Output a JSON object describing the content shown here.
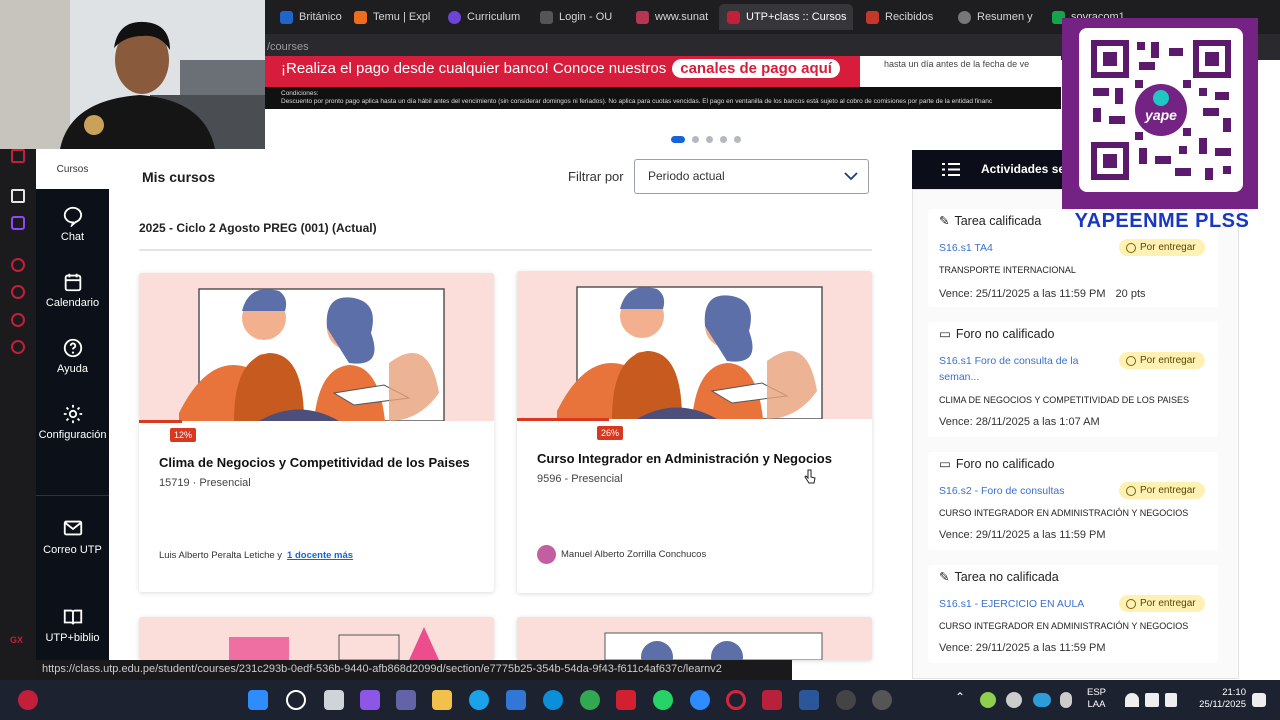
{
  "browser": {
    "tabs": [
      {
        "label": "Británico | A",
        "color": "#1f66c8"
      },
      {
        "label": "Temu | Expl",
        "color": "#ef6c1a"
      },
      {
        "label": "Curriculum",
        "color": "#6d44d8"
      },
      {
        "label": "Login - OU",
        "color": "#444"
      },
      {
        "label": "www.sunat",
        "color": "#b63552"
      },
      {
        "label": "UTP+class :: Cursos",
        "color": "#c21f3a"
      },
      {
        "label": "Recibidos",
        "color": "#c4382a"
      },
      {
        "label": "Resumen y",
        "color": "#777"
      },
      {
        "label": "sovracom1",
        "color": "#14a44a"
      }
    ],
    "address_fragment": "/courses"
  },
  "banner": {
    "main_text": "¡Realiza el pago desde cualquier banco! Conoce nuestros",
    "pill_text": "canales de pago aquí",
    "right_text": "hasta un día antes de la fecha de ve",
    "conditions_label": "Condiciones:",
    "conditions_text": "Descuento por pronto pago aplica hasta un día hábil antes del vencimiento (sin considerar domingos ni feriados). No aplica para cuotas vencidas. El pago en ventanilla de los bancos está sujeto al cobro de comisiones por parte de la entidad financ"
  },
  "sidebar": {
    "items": [
      {
        "label": "Cursos"
      },
      {
        "label": "Chat"
      },
      {
        "label": "Calendario"
      },
      {
        "label": "Ayuda"
      },
      {
        "label": "Configuración"
      },
      {
        "label": "Correo UTP"
      },
      {
        "label": "UTP+biblio"
      }
    ]
  },
  "main": {
    "heading": "Mis cursos",
    "filter_label": "Filtrar por",
    "filter_value": "Periodo actual",
    "period": "2025 - Ciclo 2 Agosto PREG (001) (Actual)",
    "carousel_dots": 5,
    "courses": [
      {
        "progress_label": "12%",
        "progress": 0.12,
        "title": "Clima de Negocios y Competitividad de los Paises",
        "subtitle": "15719 · Presencial",
        "teacher": "Luis Alberto Peralta Letiche y",
        "more_teachers": "1 docente más"
      },
      {
        "progress_label": "26%",
        "progress": 0.26,
        "title": "Curso Integrador en Administración y Negocios",
        "subtitle": "9596 - Presencial",
        "teacher": "Manuel Alberto Zorrilla Conchucos",
        "more_teachers": ""
      }
    ]
  },
  "activities": {
    "header": "Actividades se",
    "items": [
      {
        "type": "Tarea calificada",
        "link": "S16.s1 TA4",
        "status": "Por entregar",
        "course": "TRANSPORTE INTERNACIONAL",
        "due": "Vence: 25/11/2025 a las 11:59 PM",
        "points": "20 pts"
      },
      {
        "type": "Foro no calificado",
        "link": "S16.s1 Foro de consulta de la seman...",
        "status": "Por entregar",
        "course": "CLIMA DE NEGOCIOS Y COMPETITIVIDAD DE LOS PAISES",
        "due": "Vence: 28/11/2025 a las 1:07 AM",
        "points": ""
      },
      {
        "type": "Foro no calificado",
        "link": "S16.s2 - Foro de consultas",
        "status": "Por entregar",
        "course": "CURSO INTEGRADOR EN ADMINISTRACIÓN Y NEGOCIOS",
        "due": "Vence: 29/11/2025 a las 11:59 PM",
        "points": ""
      },
      {
        "type": "Tarea no calificada",
        "link": "S16.s1 - EJERCICIO EN AULA",
        "status": "Por entregar",
        "course": "CURSO INTEGRADOR EN ADMINISTRACIÓN Y NEGOCIOS",
        "due": "Vence: 29/11/2025 a las 11:59 PM",
        "points": ""
      }
    ]
  },
  "overlay": {
    "yape_text": "YAPEENME PLSS",
    "qr_logo": "yape"
  },
  "status_url": "https://class.utp.edu.pe/student/courses/231c293b-0edf-536b-9440-afb868d2099d/section/e7775b25-354b-54da-9f43-f611c4af637c/learnv2",
  "taskbar": {
    "lang_line1": "ESP",
    "lang_line2": "LAA",
    "time": "21:10",
    "date": "25/11/2025"
  },
  "colors": {
    "brand_red": "#d71d3b",
    "sidebar_bg": "#0c1018",
    "link_blue": "#1565d8",
    "badge_yellow": "#fff1b3",
    "yape_purple": "#742284"
  }
}
